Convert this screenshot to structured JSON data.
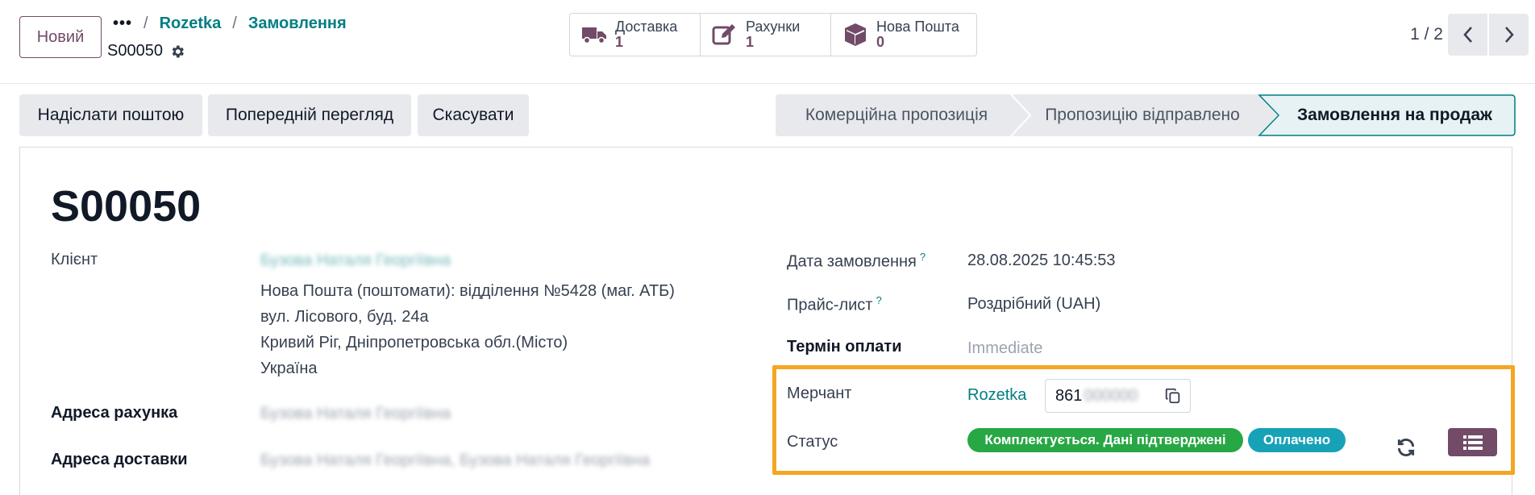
{
  "control_panel": {
    "new_button": "Новий",
    "breadcrumb": {
      "dots": "•••",
      "sep": "/",
      "items": [
        "Rozetka",
        "Замовлення"
      ]
    },
    "record_name": "S00050",
    "smart_buttons": [
      {
        "label": "Доставка",
        "value": "1",
        "icon": "truck-icon"
      },
      {
        "label": "Рахунки",
        "value": "1",
        "icon": "edit-icon"
      },
      {
        "label": "Нова Пошта",
        "value": "0",
        "icon": "box-icon"
      }
    ],
    "pager": "1 / 2"
  },
  "statusbar": {
    "actions": [
      "Надіслати поштою",
      "Попередній перегляд",
      "Скасувати"
    ],
    "stages": [
      "Комерційна пропозиція",
      "Пропозицію відправлено",
      "Замовлення на продаж"
    ],
    "active_stage": "Замовлення на продаж"
  },
  "form": {
    "title": "S00050",
    "client": {
      "label": "Клієнт",
      "name_blurred": "Бузова Наталя Георгіївна",
      "address": [
        "Нова Пошта (поштомати): відділення №5428 (маг. АТБ)",
        "вул. Лісового, буд. 24а",
        "Кривий Ріг, Дніпропетровська обл.(Місто)",
        "Україна"
      ]
    },
    "invoice_address": {
      "label": "Адреса рахунка",
      "value_blurred": "Бузова Наталя Георгіївна"
    },
    "delivery_address": {
      "label": "Адреса доставки",
      "value_blurred": "Бузова Наталя Георгіївна, Бузова Наталя Георгіївна"
    },
    "order_date": {
      "label": "Дата замовлення",
      "help": "?",
      "value": "28.08.2025 10:45:53"
    },
    "pricelist": {
      "label": "Прайс-лист",
      "help": "?",
      "value": "Роздрібний (UAH)"
    },
    "payment_term": {
      "label": "Термін оплати",
      "placeholder": "Immediate"
    },
    "merchant": {
      "label": "Мерчант",
      "value": "Rozetka",
      "id_visible": "861",
      "id_hidden": "000000"
    },
    "status": {
      "label": "Статус",
      "badges": [
        {
          "text": "Комплектується. Дані підтверджені",
          "color": "#28a745"
        },
        {
          "text": "Оплачено",
          "color": "#17a2b8"
        }
      ]
    }
  },
  "colors": {
    "brand": "#714b67",
    "link": "#017e84",
    "highlight": "#f5a623"
  }
}
